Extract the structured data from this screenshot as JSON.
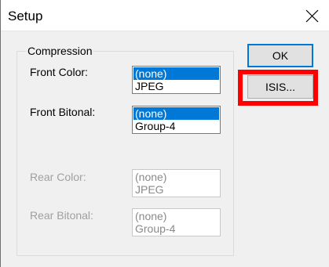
{
  "window": {
    "title": "Setup"
  },
  "compression": {
    "group_label": "Compression",
    "front_color": {
      "label": "Front Color:",
      "options": [
        "(none)",
        "JPEG"
      ],
      "selected": 0
    },
    "front_bitonal": {
      "label": "Front Bitonal:",
      "options": [
        "(none)",
        "Group-4"
      ],
      "selected": 0
    },
    "rear_color": {
      "label": "Rear Color:",
      "options": [
        "(none)",
        "JPEG"
      ]
    },
    "rear_bitonal": {
      "label": "Rear Bitonal:",
      "options": [
        "(none)",
        "Group-4"
      ]
    }
  },
  "buttons": {
    "ok": "OK",
    "isis": "ISIS..."
  },
  "colors": {
    "selection": "#0078d7",
    "annotation": "#ff0000"
  }
}
